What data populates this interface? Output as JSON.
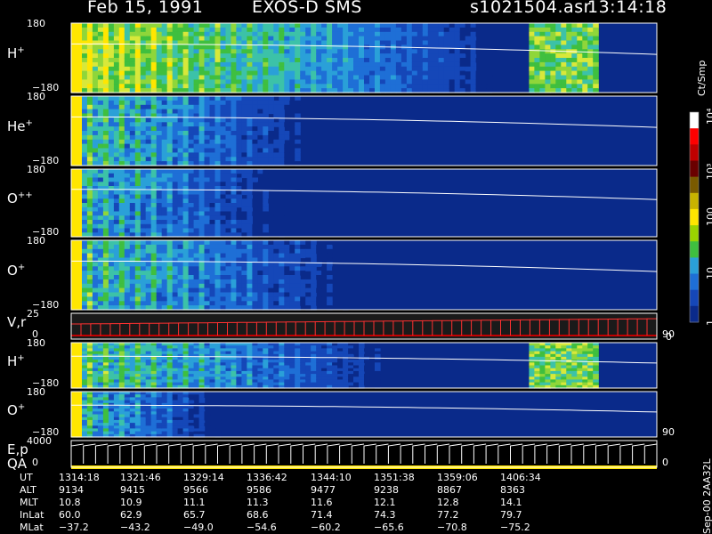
{
  "header": {
    "date": "Feb 15, 1991",
    "mission": "EXOS-D SMS",
    "file": "s1021504.asr",
    "time": "13:14:18"
  },
  "chart_data": {
    "type": "heatmap",
    "panels": [
      {
        "label": "H",
        "charge": "+",
        "ymax": "180",
        "ymin": "−180",
        "kind": "spec",
        "fade": 0.78,
        "intensity": 0.75
      },
      {
        "label": "He",
        "charge": "+",
        "ymax": "180",
        "ymin": "−180",
        "kind": "spec",
        "fade": 0.45,
        "intensity": 0.45
      },
      {
        "label": "O",
        "charge": "++",
        "ymax": "180",
        "ymin": "−180",
        "kind": "spec",
        "fade": 0.4,
        "intensity": 0.4
      },
      {
        "label": "O",
        "charge": "+",
        "ymax": "180",
        "ymin": "−180",
        "kind": "spec",
        "fade": 0.52,
        "intensity": 0.45
      },
      {
        "label": "V,r",
        "charge": "",
        "ymax": "25",
        "ymin": "0",
        "kind": "line",
        "right_label": "90"
      },
      {
        "label": "H",
        "charge": "+",
        "ymax": "180",
        "ymin": "−180",
        "kind": "spec",
        "fade": 0.6,
        "intensity": 0.5
      },
      {
        "label": "O",
        "charge": "+",
        "ymax": "180",
        "ymin": "−180",
        "kind": "spec",
        "fade": 0.28,
        "intensity": 0.4,
        "right_label": "90"
      },
      {
        "label": "E,p",
        "label2": "QA",
        "charge": "",
        "ymax": "4000",
        "ymin": "0",
        "kind": "sawtooth",
        "right_label": "0"
      }
    ],
    "colorbar": {
      "unit": "Ct/Smp",
      "labels": [
        "10⁴",
        "10³",
        "100",
        "10",
        "1"
      ],
      "right_bottom_label": "0"
    },
    "colors": {
      "low": "#0a2a8a",
      "mid": "#3fbf3f",
      "high": "#ffe600",
      "max": "#d00000"
    }
  },
  "footer": {
    "rows": [
      {
        "name": "UT",
        "values": [
          "1314:18",
          "1321:46",
          "1329:14",
          "1336:42",
          "1344:10",
          "1351:38",
          "1359:06",
          "1406:34"
        ]
      },
      {
        "name": "ALT",
        "values": [
          "9134",
          "9415",
          "9566",
          "9586",
          "9477",
          "9238",
          "8867",
          "8363"
        ]
      },
      {
        "name": "MLT",
        "values": [
          "10.8",
          "10.9",
          "11.1",
          "11.3",
          "11.6",
          "12.1",
          "12.8",
          "14.1"
        ]
      },
      {
        "name": "InLat",
        "values": [
          "60.0",
          "62.9",
          "65.7",
          "68.6",
          "71.4",
          "74.3",
          "77.2",
          "79.7"
        ]
      },
      {
        "name": "MLat",
        "values": [
          "−37.2",
          "−43.2",
          "−49.0",
          "−54.6",
          "−60.2",
          "−65.6",
          "−70.8",
          "−75.2"
        ]
      }
    ],
    "vertical_note": "Sep-00 2AA32L"
  }
}
